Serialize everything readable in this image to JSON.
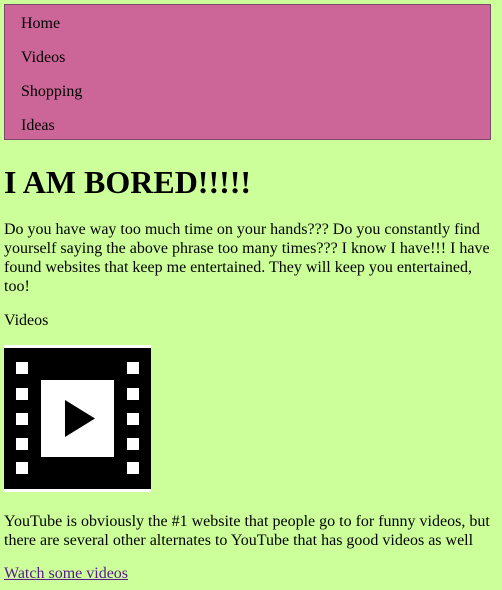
{
  "nav": {
    "items": [
      {
        "label": "Home"
      },
      {
        "label": "Videos"
      },
      {
        "label": "Shopping"
      },
      {
        "label": "Ideas"
      }
    ]
  },
  "main": {
    "heading": "I AM BORED!!!!!",
    "intro": "Do you have way too much time on your hands??? Do you constantly find yourself saying the above phrase too many times??? I know I have!!! I have found websites that keep me entertained. They will keep you entertained, too!",
    "section_label": "Videos",
    "video_icon": "film-strip-play-icon",
    "description": "YouTube is obviously the #1 website that people go to for funny videos, but there are several other alternates to YouTube that has good videos as well",
    "link_text": "Watch some videos"
  },
  "colors": {
    "page_background": "#ccff99",
    "nav_background": "#cc6699",
    "link": "#551a8b"
  }
}
